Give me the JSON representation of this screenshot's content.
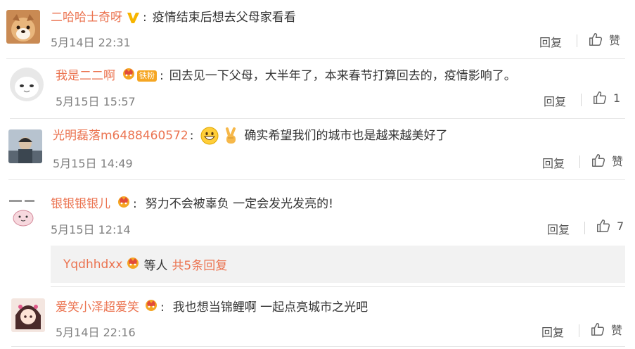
{
  "comments": [
    {
      "username": "二哈哈士奇呀",
      "text": "疫情结束后想去父母家看看",
      "time": "5月14日 22:31",
      "reply": "回复",
      "like": "赞"
    },
    {
      "username": "我是二二啊",
      "fan_badge": "铁粉",
      "text": "回去见一下父母，大半年了，本来春节打算回去的，疫情影响了。",
      "time": "5月15日 15:57",
      "reply": "回复",
      "like": "1"
    },
    {
      "username": "光明磊落m6488460572",
      "text": "确实希望我们的城市也是越来越美好了",
      "time": "5月15日 14:49",
      "reply": "回复",
      "like": "赞"
    },
    {
      "username": "银银银银儿",
      "text": "努力不会被辜负 一定会发光发亮的!",
      "time": "5月15日 12:14",
      "reply": "回复",
      "like": "7"
    },
    {
      "username": "爱笑小泽超爱笑",
      "text": "我也想当锦鲤啊  一起点亮城市之光吧",
      "time": "5月14日 22:16",
      "reply": "回复",
      "like": "赞"
    }
  ],
  "sub_reply": {
    "username": "Yqdhhdxx",
    "others": "等人",
    "more": "共5条回复"
  },
  "colon": ":",
  "icons": {
    "verified": "v-verified-icon",
    "member_crown": "vip-crown-icon",
    "like": "thumbs-up-icon",
    "emoji_grin": "grin-emoji-icon",
    "emoji_victory": "victory-hand-emoji-icon"
  },
  "colors": {
    "username": "#eb7350",
    "meta": "#808080",
    "subbox": "#f2f2f2",
    "verified": "#f7b500"
  }
}
